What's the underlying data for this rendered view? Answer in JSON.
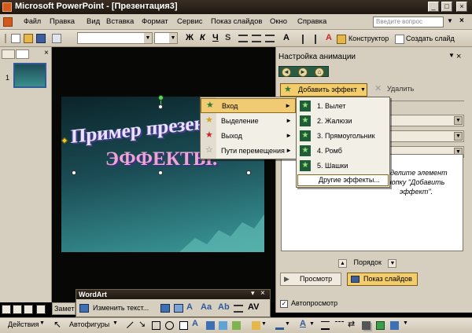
{
  "window": {
    "title": "Microsoft PowerPoint - [Презентация3]"
  },
  "menubar": {
    "items": [
      "Файл",
      "Правка",
      "Вид",
      "Вставка",
      "Формат",
      "Сервис",
      "Показ слайдов",
      "Окно",
      "Справка"
    ],
    "help_placeholder": "Введите вопрос"
  },
  "toolbar": {
    "bold": "Ж",
    "italic": "К",
    "underline": "Ч",
    "shadow": "S",
    "font_grow": "A",
    "constructor": "Конструктор",
    "new_slide": "Создать слайд"
  },
  "slides": {
    "thumb_number": "1"
  },
  "slide": {
    "wordart_line1": "Пример презен",
    "wordart_line2": "ЭФФЕКТЫ."
  },
  "notes_tab": "Замет",
  "wordart_toolbar": {
    "title": "WordArt",
    "edit_text": "Изменить текст..."
  },
  "effect_menu": {
    "items": [
      {
        "label": "Вход",
        "icon": "entrance-star-icon",
        "color": "#2e7d32"
      },
      {
        "label": "Выделение",
        "icon": "emphasis-star-icon",
        "color": "#d4a017"
      },
      {
        "label": "Выход",
        "icon": "exit-star-icon",
        "color": "#c62828"
      },
      {
        "label": "Пути перемещения",
        "icon": "motion-path-star-icon",
        "color": "#777777"
      }
    ]
  },
  "entrance_submenu": {
    "items": [
      "1. Вылет",
      "2. Жалюзи",
      "3. Прямоугольник",
      "4. Ромб",
      "5. Шашки"
    ],
    "more": "Другие эффекты..."
  },
  "taskpane": {
    "title": "Настройка анимации",
    "add_effect": "Добавить эффект",
    "remove": "Удалить",
    "hint": "ыделите элемент\nнопку \"Добавить\nэффект\".",
    "order": "Порядок",
    "play": "Просмотр",
    "slideshow": "Показ слайдов",
    "autopreview": "Автопросмотр"
  },
  "drawbar": {
    "actions": "Действия",
    "autoshapes": "Автофигуры"
  }
}
